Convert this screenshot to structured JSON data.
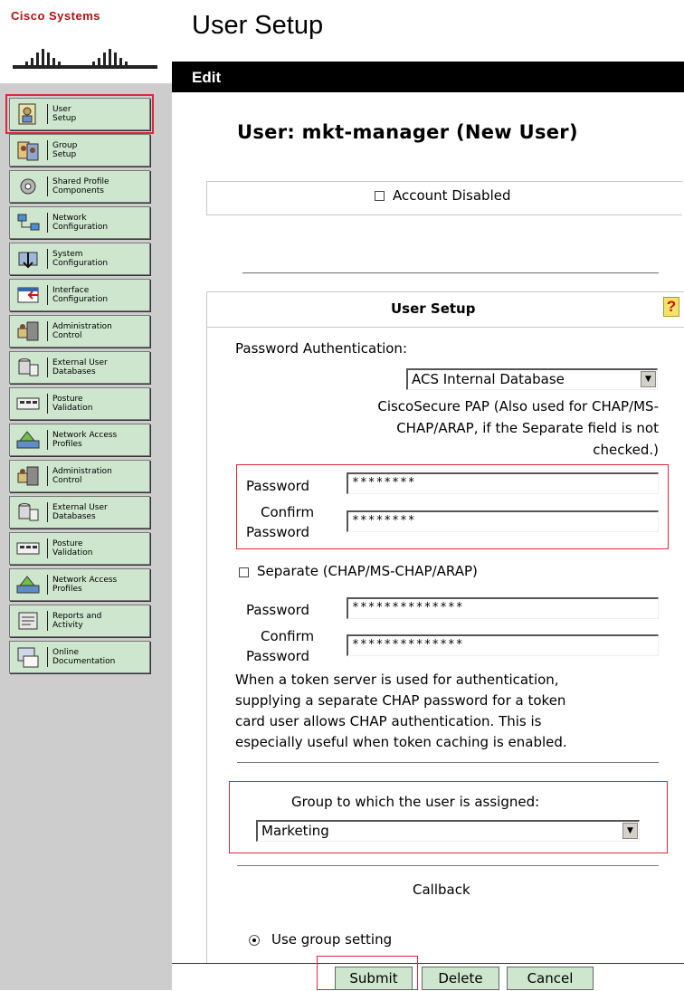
{
  "brand": {
    "name": "Cisco Systems"
  },
  "page": {
    "title": "User Setup",
    "edit_label": "Edit"
  },
  "sidebar": {
    "items": [
      {
        "label": "User\nSetup",
        "icon": "user-setup-icon",
        "selected": true
      },
      {
        "label": "Group\nSetup",
        "icon": "group-setup-icon"
      },
      {
        "label": "Shared Profile\nComponents",
        "icon": "shared-profile-icon"
      },
      {
        "label": "Network\nConfiguration",
        "icon": "network-config-icon"
      },
      {
        "label": "System\nConfiguration",
        "icon": "system-config-icon"
      },
      {
        "label": "Interface\nConfiguration",
        "icon": "interface-config-icon"
      },
      {
        "label": "Administration\nControl",
        "icon": "administration-icon"
      },
      {
        "label": "External User\nDatabases",
        "icon": "database-icon"
      },
      {
        "label": "Posture\nValidation",
        "icon": "posture-icon"
      },
      {
        "label": "Network Access\nProfiles",
        "icon": "network-access-icon"
      },
      {
        "label": "Administration\nControl",
        "icon": "administration-icon"
      },
      {
        "label": "External User\nDatabases",
        "icon": "database-icon"
      },
      {
        "label": "Posture\nValidation",
        "icon": "posture-icon"
      },
      {
        "label": "Network Access\nProfiles",
        "icon": "network-access-icon"
      },
      {
        "label": "Reports and\nActivity",
        "icon": "reports-icon"
      },
      {
        "label": "Online\nDocumentation",
        "icon": "documentation-icon"
      }
    ]
  },
  "main": {
    "user_heading": "User: mkt-manager (New User)",
    "account_disabled_label": "Account Disabled",
    "user_setup_header": "User Setup",
    "help_icon": "?",
    "password_auth_label": "Password Authentication:",
    "auth_db_value": "ACS Internal Database",
    "pap_note_1": "CiscoSecure PAP (Also used for CHAP/MS-",
    "pap_note_2": "CHAP/ARAP, if the Separate field is not",
    "pap_note_3": "checked.)",
    "password_label": "Password",
    "confirm_label_1": "Confirm",
    "confirm_label_2": "Password",
    "pap_password": "********",
    "pap_confirm": "********",
    "separate_label": "Separate (CHAP/MS-CHAP/ARAP)",
    "chap_password": "**************",
    "chap_confirm": "**************",
    "token_note_1": "When a token server is used for authentication,",
    "token_note_2": "supplying a separate CHAP password for a token",
    "token_note_3": "card user allows CHAP authentication. This is",
    "token_note_4": "especially useful when token caching is enabled.",
    "group_label": "Group to which the user is assigned:",
    "group_value": "Marketing",
    "callback_label": "Callback",
    "use_group_setting_label": "Use group setting"
  },
  "buttons": {
    "submit": "Submit",
    "delete": "Delete",
    "cancel": "Cancel"
  },
  "colors": {
    "nav_button": "#cde6cd",
    "sidebar_bg": "#cdcdcd",
    "highlight": "#e0263b",
    "edit_bar": "#000000"
  }
}
